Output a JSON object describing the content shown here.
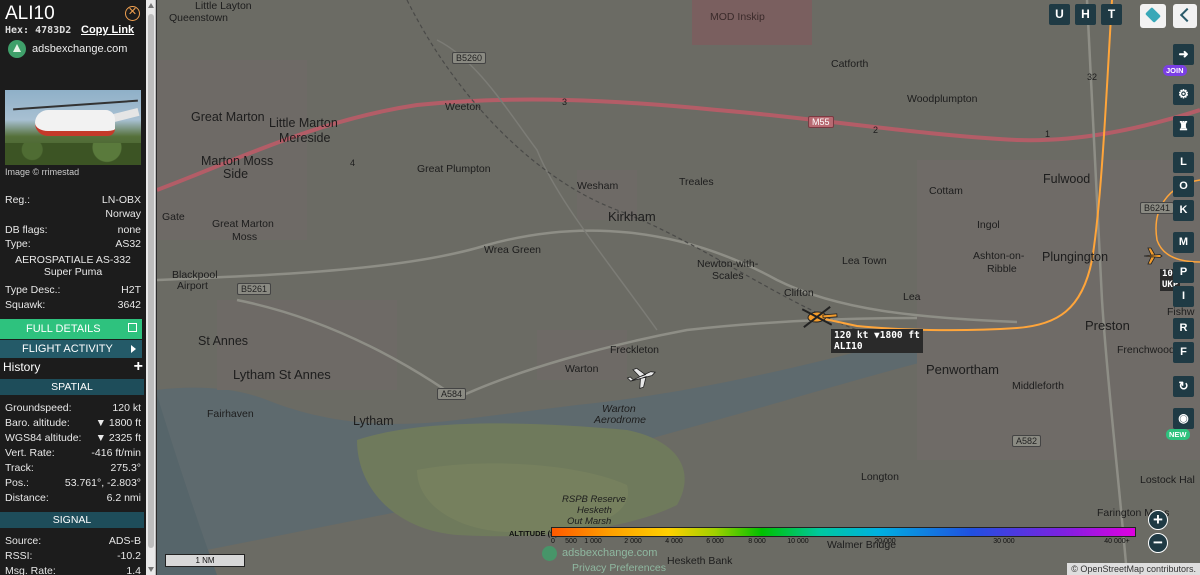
{
  "sidebar": {
    "callsign": "ALI10",
    "hex_label": "Hex:",
    "hex_value": "4783D2",
    "copy_link": "Copy Link",
    "brand": "adsbexchange.com",
    "photo_credit": "Image © rrimestad",
    "reg_label": "Reg.:",
    "reg_value": "LN-OBX",
    "country": "Norway",
    "dbflags_label": "DB flags:",
    "dbflags_value": "none",
    "type_label": "Type:",
    "type_value": "AS32",
    "type_desc_line1": "AEROSPATIALE AS-332",
    "type_desc_line2": "Super Puma",
    "typedesc_label": "Type Desc.:",
    "typedesc_value": "H2T",
    "squawk_label": "Squawk:",
    "squawk_value": "3642",
    "full_details": "FULL DETAILS",
    "flight_activity": "FLIGHT ACTIVITY",
    "history": "History",
    "history_plus": "+",
    "spatial_header": "SPATIAL",
    "groundspeed_label": "Groundspeed:",
    "groundspeed_value": "120 kt",
    "baro_label": "Baro. altitude:",
    "baro_value": "▼ 1800 ft",
    "wgs_label": "WGS84 altitude:",
    "wgs_value": "▼ 2325 ft",
    "vrate_label": "Vert. Rate:",
    "vrate_value": "-416 ft/min",
    "track_label": "Track:",
    "track_value": "275.3°",
    "pos_label": "Pos.:",
    "pos_value": "53.761°, -2.803°",
    "distance_label": "Distance:",
    "distance_value": "6.2 nmi",
    "signal_header": "SIGNAL",
    "source_label": "Source:",
    "source_value": "ADS-B",
    "rssi_label": "RSSI:",
    "rssi_value": "-10.2",
    "msgrate_label": "Msg. Rate:",
    "msgrate_value": "1.4"
  },
  "map": {
    "places": {
      "queenstown": "Queenstown",
      "little_layton": "Little Layton",
      "great_marton": "Great Marton",
      "little_marton": "Little Marton",
      "mereside": "Mereside",
      "marton_moss_side_1": "Marton Moss",
      "marton_moss_side_2": "Side",
      "great_plumpton": "Great Plumpton",
      "weeton": "Weeton",
      "wesham": "Wesham",
      "treales": "Treales",
      "kirkham": "Kirkham",
      "catforth": "Catforth",
      "woodplumpton": "Woodplumpton",
      "fulwood": "Fulwood",
      "cottam": "Cottam",
      "ingol": "Ingol",
      "gate": "Gate",
      "great_marton_moss_1": "Great Marton",
      "great_marton_moss_2": "Moss",
      "wrea_green": "Wrea Green",
      "newton_1": "Newton-with-",
      "newton_2": "Scales",
      "lea_town": "Lea Town",
      "ashton_1": "Ashton-on-",
      "ashton_2": "Ribble",
      "plungington": "Plungington",
      "blackpool_airport_1": "Blackpool",
      "blackpool_airport_2": "Airport",
      "clifton": "Clifton",
      "lea": "Lea",
      "preston": "Preston",
      "st_annes": "St Annes",
      "freckleton": "Freckleton",
      "frenchwood": "Frenchwood",
      "lytham_st_annes": "Lytham St Annes",
      "warton": "Warton",
      "penwortham": "Penwortham",
      "middleforth": "Middleforth",
      "fairhaven": "Fairhaven",
      "lytham": "Lytham",
      "warton_aerodrome_1": "Warton",
      "warton_aerodrome_2": "Aerodrome",
      "longton": "Longton",
      "lostock_hall": "Lostock Hal",
      "farington_moss": "Farington Moss",
      "rspb_1": "RSPB Reserve",
      "rspb_2": "Hesketh",
      "rspb_3": "Out Marsh",
      "walmer_bridge": "Walmer Bridge",
      "hesketh_bank": "Hesketh Bank",
      "mod_inskip": "MOD Inskip",
      "fishwick": "Fishw"
    },
    "roads": {
      "b5260": "B5260",
      "m55": "M55",
      "b5261": "B5261",
      "a584": "A584",
      "a582": "A582",
      "b6241": "B6241",
      "j3": "3",
      "j4": "4",
      "j2": "2",
      "j1": "1",
      "j32": "32"
    },
    "aircraft_tag_line1": "120 kt  ▼1800 ft",
    "aircraft_tag_line2": "ALI10",
    "other_tag_line1": "10",
    "other_tag_line2": "UKP",
    "buttons_top": [
      "U",
      "H",
      "T"
    ],
    "buttons_right": [
      "L",
      "O",
      "K",
      "M",
      "P",
      "I",
      "R",
      "F"
    ],
    "join_badge": "JOIN",
    "new_badge": "NEW",
    "zoom_in": "+",
    "zoom_out": "−",
    "altitude_label": "ALTITUDE (ft)",
    "altitude_ticks": [
      "0",
      "500",
      "1 000",
      "2 000",
      "4 000",
      "6 000",
      "8 000",
      "10 000",
      "20 000",
      "30 000",
      "40 000+"
    ],
    "scale": "1 NM",
    "watermark": "adsbexchange.com",
    "privacy": "Privacy Preferences",
    "attribution": "© OpenStreetMap contributors."
  },
  "colors": {
    "accent_green": "#2ec27e",
    "teal_dark": "#1e4d5a",
    "track_orange": "#ffa53a",
    "plane_orange": "#f39c2c"
  }
}
